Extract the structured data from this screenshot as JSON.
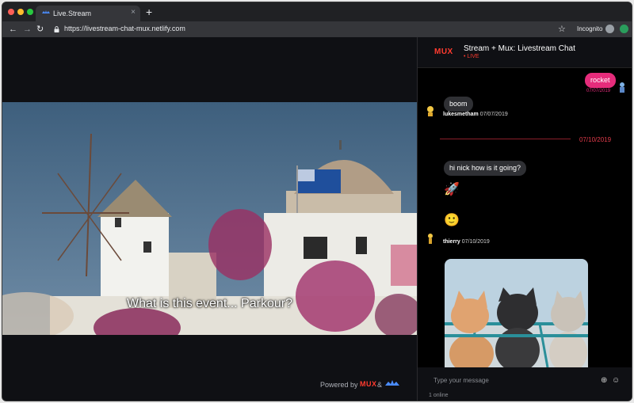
{
  "browser": {
    "tab_title": "Live.Stream",
    "tab_close": "×",
    "new_tab": "+",
    "back": "←",
    "forward": "→",
    "reload": "↻",
    "url": "https://livestream-chat-mux.netlify.com",
    "star": "☆",
    "incognito_label": "Incognito"
  },
  "video": {
    "caption": "What is this event... Parkour?",
    "powered_by": "Powered by",
    "powered_mux": "MUX",
    "powered_amp": "&"
  },
  "chat": {
    "logo": "MUX",
    "title": "Stream + Mux: Livestream Chat",
    "live": "• LIVE",
    "messages": [
      {
        "text": "rocket",
        "time": "07/07/2019"
      },
      {
        "text": "boom",
        "user": "lukesmetham",
        "time": "07/07/2019"
      },
      {
        "text": "hi nick how is it going?",
        "emoji1": "🚀",
        "emoji2": "🙂",
        "user": "thierry",
        "time": "07/10/2019"
      }
    ],
    "date_divider": "07/10/2019",
    "input_placeholder": "Type your message",
    "add_icon": "⊕",
    "emoji_icon": "☺",
    "online": "1 online"
  },
  "colors": {
    "accent_pink": "#e52c7b",
    "mux_red": "#ff3b2f",
    "background": "#0f1014"
  }
}
